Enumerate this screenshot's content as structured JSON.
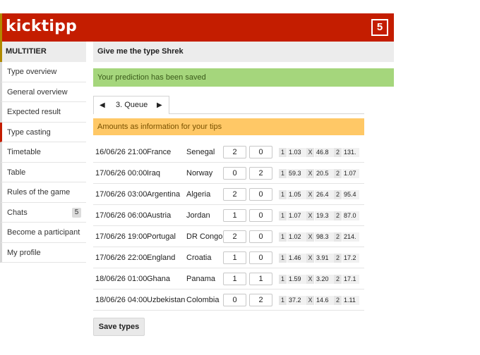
{
  "header": {
    "logo": "kicktipp",
    "matchday": "5"
  },
  "sidebar": {
    "title": "MULTITIER",
    "items": [
      {
        "label": "Type overview"
      },
      {
        "label": "General overview"
      },
      {
        "label": "Expected result"
      },
      {
        "label": "Type casting",
        "active": true
      },
      {
        "label": "Timetable"
      },
      {
        "label": "Table"
      },
      {
        "label": "Rules of the game"
      },
      {
        "label": "Chats",
        "badge": "5"
      },
      {
        "label": "Become a participant"
      },
      {
        "label": "My profile"
      }
    ]
  },
  "main": {
    "title": "Give me the type Shrek",
    "success_message": "Your prediction has been saved",
    "queue": {
      "prev_icon": "◀",
      "label": "3. Queue",
      "next_icon": "▶"
    },
    "info_message": "Amounts as information for your tips",
    "matches": [
      {
        "date": "16/06/26 21:00",
        "home": "France",
        "away": "Senegal",
        "home_goals": "2",
        "away_goals": "0",
        "odd_1": "1.03",
        "odd_x": "46.8",
        "odd_2": "131."
      },
      {
        "date": "17/06/26 00:00",
        "home": "Iraq",
        "away": "Norway",
        "home_goals": "0",
        "away_goals": "2",
        "odd_1": "59.3",
        "odd_x": "20.5",
        "odd_2": "1.07"
      },
      {
        "date": "17/06/26 03:00",
        "home": "Argentina",
        "away": "Algeria",
        "home_goals": "2",
        "away_goals": "0",
        "odd_1": "1.05",
        "odd_x": "26.4",
        "odd_2": "95.4"
      },
      {
        "date": "17/06/26 06:00",
        "home": "Austria",
        "away": "Jordan",
        "home_goals": "1",
        "away_goals": "0",
        "odd_1": "1.07",
        "odd_x": "19.3",
        "odd_2": "87.0"
      },
      {
        "date": "17/06/26 19:00",
        "home": "Portugal",
        "away": "DR Congo",
        "home_goals": "2",
        "away_goals": "0",
        "odd_1": "1.02",
        "odd_x": "98.3",
        "odd_2": "214."
      },
      {
        "date": "17/06/26 22:00",
        "home": "England",
        "away": "Croatia",
        "home_goals": "1",
        "away_goals": "0",
        "odd_1": "1.46",
        "odd_x": "3.91",
        "odd_2": "17.2"
      },
      {
        "date": "18/06/26 01:00",
        "home": "Ghana",
        "away": "Panama",
        "home_goals": "1",
        "away_goals": "1",
        "odd_1": "1.59",
        "odd_x": "3.20",
        "odd_2": "17.1"
      },
      {
        "date": "18/06/26 04:00",
        "home": "Uzbekistan",
        "away": "Colombia",
        "home_goals": "0",
        "away_goals": "2",
        "odd_1": "37.2",
        "odd_x": "14.6",
        "odd_2": "1.11"
      }
    ],
    "odd_labels": {
      "one": "1",
      "x": "X",
      "two": "2"
    },
    "save_label": "Save types"
  },
  "colors": {
    "brand": "#c41d00",
    "success": "#a5d67c",
    "info": "#ffc866"
  }
}
